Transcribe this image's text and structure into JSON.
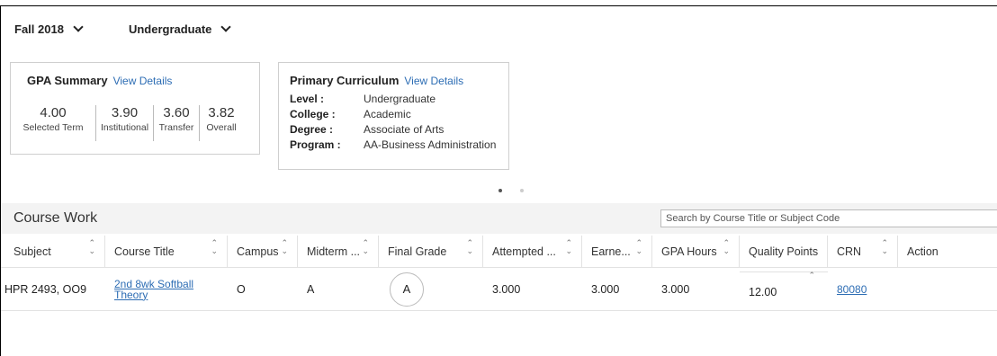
{
  "header": {
    "term": "Fall 2018",
    "level": "Undergraduate"
  },
  "gpa_summary": {
    "title": "GPA Summary",
    "link": "View Details",
    "values": [
      {
        "value": "4.00",
        "label": "Selected Term"
      },
      {
        "value": "3.90",
        "label": "Institutional"
      },
      {
        "value": "3.60",
        "label": "Transfer"
      },
      {
        "value": "3.82",
        "label": "Overall"
      }
    ]
  },
  "curriculum": {
    "title": "Primary Curriculum",
    "link": "View Details",
    "items": [
      {
        "key": "Level :",
        "value": "Undergraduate"
      },
      {
        "key": "College :",
        "value": "Academic"
      },
      {
        "key": "Degree :",
        "value": "Associate of Arts"
      },
      {
        "key": "Program :",
        "value": "AA-Business Administration"
      }
    ]
  },
  "course_work": {
    "title": "Course Work",
    "search_placeholder": "Search by Course Title or Subject Code",
    "columns": [
      "Subject",
      "Course Title",
      "Campus",
      "Midterm ...",
      "Final Grade",
      "Attempted ...",
      "Earne...",
      "GPA Hours",
      "Quality Points",
      "CRN",
      "Action"
    ],
    "rows": [
      {
        "subject": "HPR 2493, OO9",
        "course_title": "2nd 8wk Softball Theory",
        "campus": "O",
        "midterm": "A",
        "final_grade": "A",
        "attempted": "3.000",
        "earned": "3.000",
        "gpa_hours": "3.000",
        "quality_points": "12.00",
        "crn": "80080",
        "action": ""
      }
    ]
  },
  "icons": {
    "sort": "sort-arrows-icon",
    "dropdown": "chevron-down-icon"
  }
}
